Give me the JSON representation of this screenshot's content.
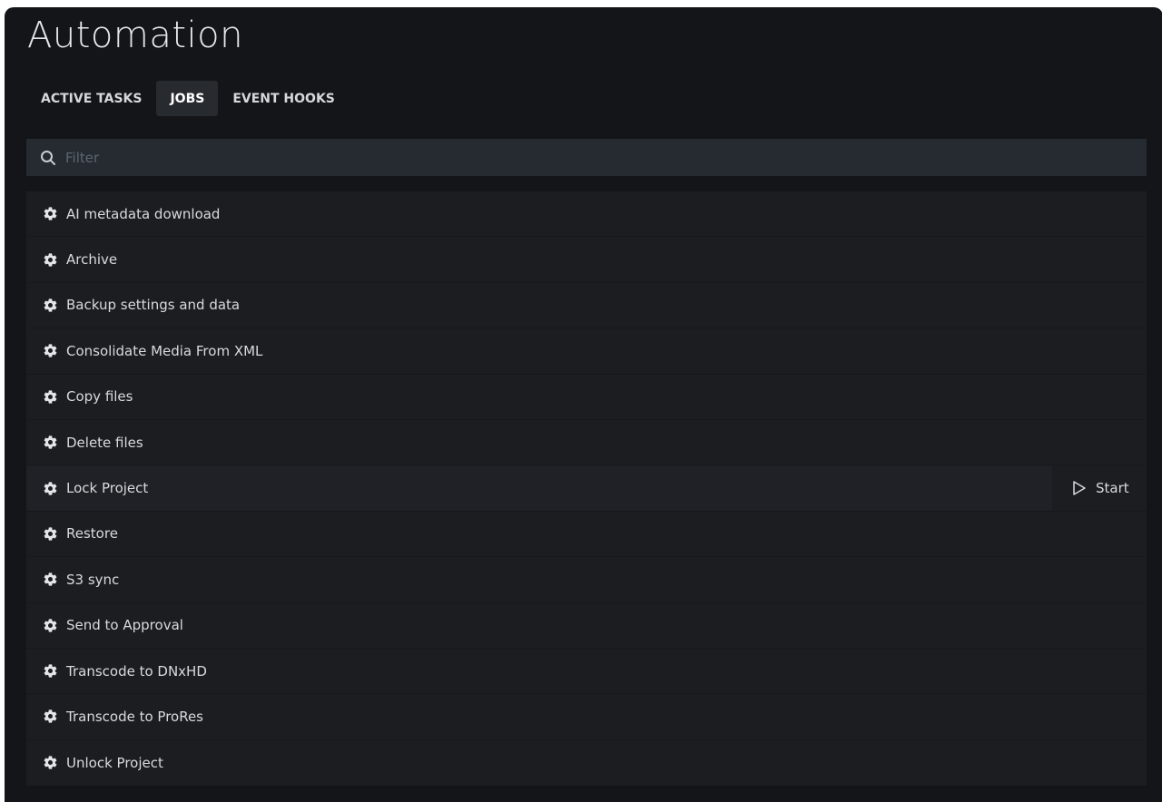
{
  "page": {
    "title": "Automation"
  },
  "tabs": [
    {
      "label": "ACTIVE TASKS",
      "active": false
    },
    {
      "label": "JOBS",
      "active": true
    },
    {
      "label": "EVENT HOOKS",
      "active": false
    }
  ],
  "filter": {
    "placeholder": "Filter",
    "value": ""
  },
  "jobs": [
    {
      "label": "AI metadata download",
      "icon": "gear-icon"
    },
    {
      "label": "Archive",
      "icon": "gear-icon"
    },
    {
      "label": "Backup settings and data",
      "icon": "gear-icon"
    },
    {
      "label": "Consolidate Media From XML",
      "icon": "gear-icon"
    },
    {
      "label": "Copy files",
      "icon": "gear-icon"
    },
    {
      "label": "Delete files",
      "icon": "gear-icon"
    },
    {
      "label": "Lock Project",
      "icon": "gear-icon",
      "hovered": true,
      "action_label": "Start",
      "action_icon": "play-icon"
    },
    {
      "label": "Restore",
      "icon": "gear-icon"
    },
    {
      "label": "S3 sync",
      "icon": "gear-icon"
    },
    {
      "label": "Send to Approval",
      "icon": "gear-icon"
    },
    {
      "label": "Transcode to DNxHD",
      "icon": "gear-icon"
    },
    {
      "label": "Transcode to ProRes",
      "icon": "gear-icon"
    },
    {
      "label": "Unlock Project",
      "icon": "gear-icon"
    }
  ],
  "colors": {
    "background": "#131518",
    "surface": "#1b1d21",
    "filter_bg": "#252b31",
    "tab_active_bg": "#272a2f",
    "text": "#d8dadd"
  }
}
